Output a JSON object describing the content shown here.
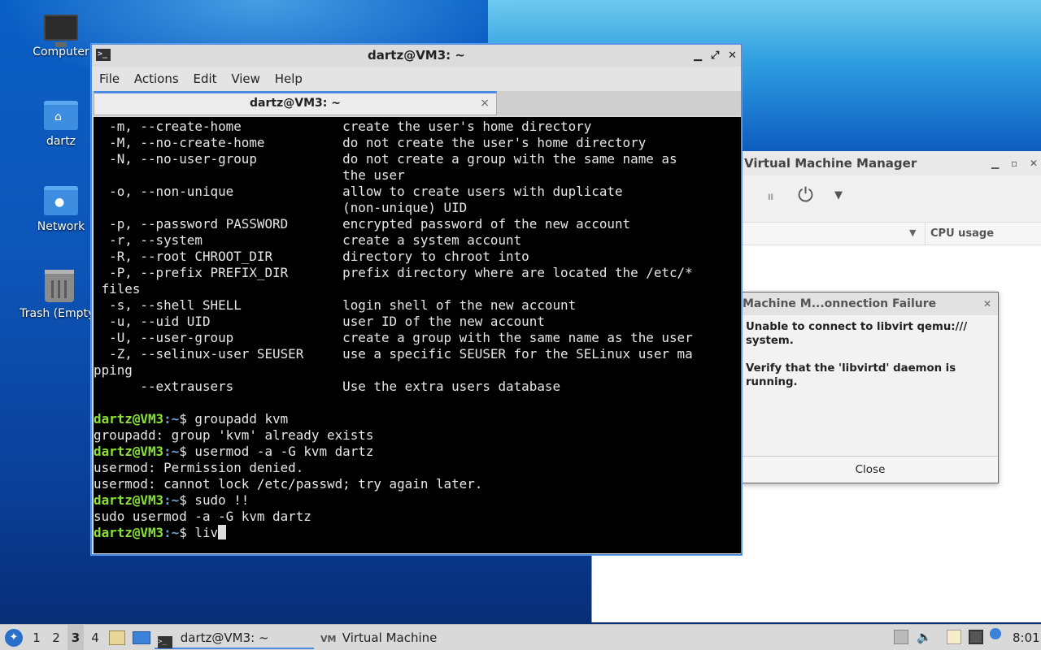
{
  "desktop": {
    "icons": [
      {
        "label": "Computer",
        "icon": "computer-icon"
      },
      {
        "label": "dartz",
        "icon": "home-folder-icon"
      },
      {
        "label": "Network",
        "icon": "network-folder-icon"
      },
      {
        "label": "Trash (Empty)",
        "icon": "trash-icon"
      }
    ]
  },
  "terminal": {
    "title": "dartz@VM3: ~",
    "menu": [
      "File",
      "Actions",
      "Edit",
      "View",
      "Help"
    ],
    "tab_label": "dartz@VM3: ~",
    "tab_close": "×",
    "lines": [
      {
        "plain": "  -m, --create-home             create the user's home directory"
      },
      {
        "plain": "  -M, --no-create-home          do not create the user's home directory"
      },
      {
        "plain": "  -N, --no-user-group           do not create a group with the same name as"
      },
      {
        "plain": "                                the user"
      },
      {
        "plain": "  -o, --non-unique              allow to create users with duplicate"
      },
      {
        "plain": "                                (non-unique) UID"
      },
      {
        "plain": "  -p, --password PASSWORD       encrypted password of the new account"
      },
      {
        "plain": "  -r, --system                  create a system account"
      },
      {
        "plain": "  -R, --root CHROOT_DIR         directory to chroot into"
      },
      {
        "plain": "  -P, --prefix PREFIX_DIR       prefix directory where are located the /etc/*"
      },
      {
        "plain": " files"
      },
      {
        "plain": "  -s, --shell SHELL             login shell of the new account"
      },
      {
        "plain": "  -u, --uid UID                 user ID of the new account"
      },
      {
        "plain": "  -U, --user-group              create a group with the same name as the user"
      },
      {
        "plain": "  -Z, --selinux-user SEUSER     use a specific SEUSER for the SELinux user ma"
      },
      {
        "plain": "pping"
      },
      {
        "plain": "      --extrausers              Use the extra users database"
      },
      {
        "plain": ""
      },
      {
        "prompt": "dartz@VM3",
        "path": ":~",
        "cmd": "$ groupadd kvm"
      },
      {
        "plain": "groupadd: group 'kvm' already exists"
      },
      {
        "prompt": "dartz@VM3",
        "path": ":~",
        "cmd": "$ usermod -a -G kvm dartz"
      },
      {
        "plain": "usermod: Permission denied."
      },
      {
        "plain": "usermod: cannot lock /etc/passwd; try again later."
      },
      {
        "prompt": "dartz@VM3",
        "path": ":~",
        "cmd": "$ sudo !!"
      },
      {
        "plain": "sudo usermod -a -G kvm dartz"
      },
      {
        "prompt": "dartz@VM3",
        "path": ":~",
        "cmd": "$ liv",
        "cursor": true
      }
    ]
  },
  "vmm": {
    "title": "Virtual Machine Manager",
    "column_cpu": "CPU usage"
  },
  "dialog": {
    "title": "Virtual Machine Manager Connection Failure",
    "title_display": "Machine M...onnection Failure",
    "message_line1": "Unable to connect to libvirt qemu:///",
    "message_line2": "system.",
    "message_line3": "Verify that the 'libvirtd' daemon is",
    "message_line4": "running.",
    "close_label": "Close"
  },
  "taskbar": {
    "workspaces": [
      "1",
      "2",
      "3",
      "4"
    ],
    "active_workspace": "3",
    "tasks": [
      {
        "label": "dartz@VM3: ~",
        "active": true
      },
      {
        "label": "Virtual Machine Mana...",
        "active": false
      }
    ],
    "clock": "8:01"
  }
}
